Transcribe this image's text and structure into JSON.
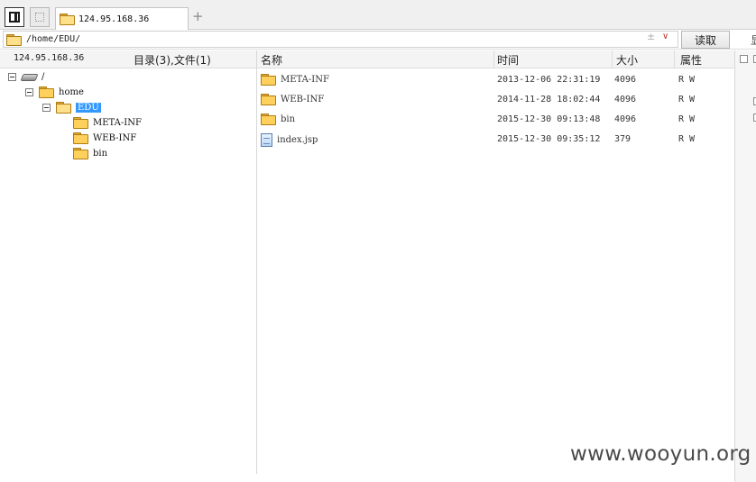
{
  "tab": {
    "title": "124.95.168.36",
    "add_label": "+"
  },
  "address": {
    "path": "/home/EDU/",
    "pin_glyph": "±",
    "dropdown_glyph": "∨",
    "read_button": "读取",
    "edge_char": "显"
  },
  "left_panel": {
    "host": "124.95.168.36",
    "summary": "目录(3),文件(1)",
    "tree": {
      "root": "/",
      "home": "home",
      "edu": "EDU",
      "children": [
        "META-INF",
        "WEB-INF",
        "bin"
      ]
    }
  },
  "file_list": {
    "columns": [
      "名称",
      "时间",
      "大小",
      "属性"
    ],
    "rows": [
      {
        "name": "META-INF",
        "time": "2013-12-06 22:31:19",
        "size": "4096",
        "attr": "R W",
        "type": "folder"
      },
      {
        "name": "WEB-INF",
        "time": "2014-11-28 18:02:44",
        "size": "4096",
        "attr": "R W",
        "type": "folder"
      },
      {
        "name": "bin",
        "time": "2015-12-30 09:13:48",
        "size": "4096",
        "attr": "R W",
        "type": "folder"
      },
      {
        "name": "index.jsp",
        "time": "2015-12-30 09:35:12",
        "size": "379",
        "attr": "R W",
        "type": "file"
      }
    ]
  },
  "watermark": "www.wooyun.org"
}
